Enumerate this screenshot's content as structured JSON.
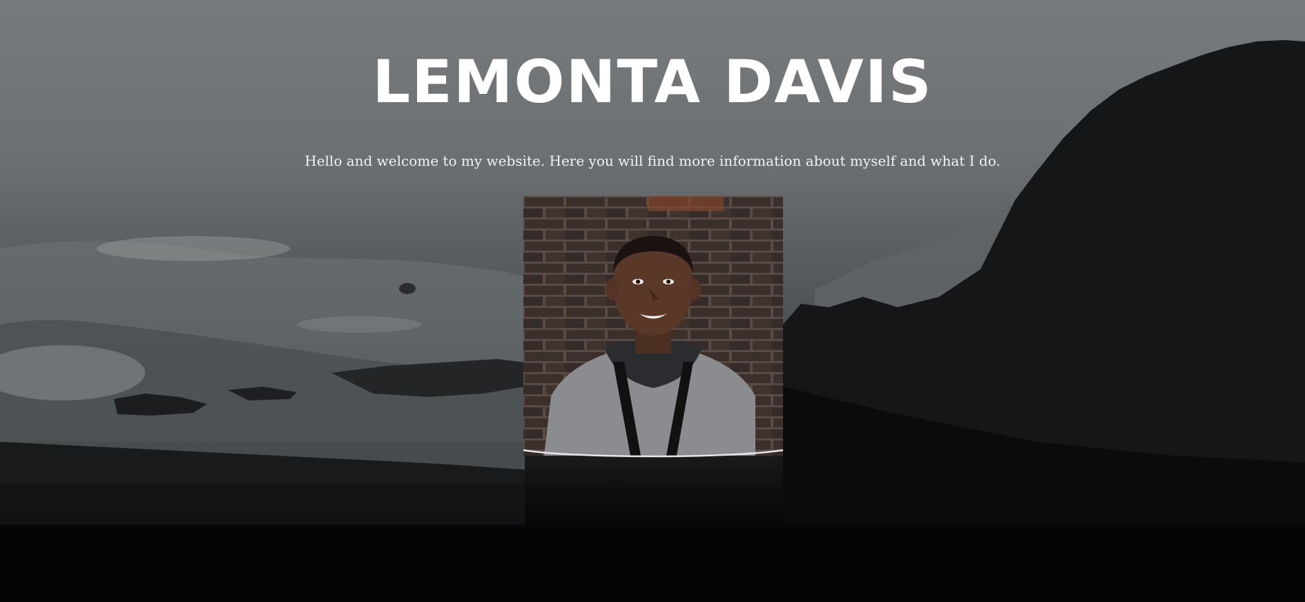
{
  "hero": {
    "title": "LEMONTA DAVIS",
    "subtitle": "Hello and welcome to my website. Here you will find more information about myself and what I do."
  },
  "portrait": {
    "alt": "Portrait of Lemonta Davis in front of a brick wall"
  },
  "background": {
    "scene": "stormy rocky coastline",
    "colors": {
      "sky": "#767a7c",
      "sea": "#4e5355",
      "cliff": "#151617",
      "ground": "#050505"
    }
  }
}
